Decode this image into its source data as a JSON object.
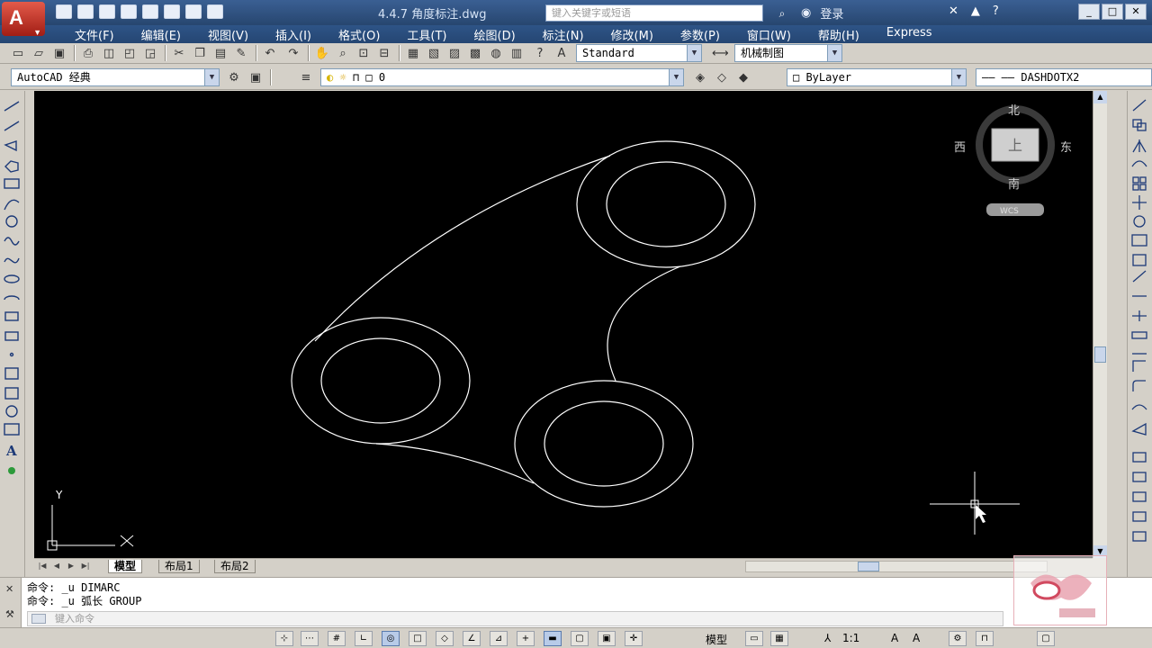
{
  "titlebar": {
    "app_letter": "A",
    "document_title": "4.4.7 角度标注.dwg",
    "search_placeholder": "键入关键字或短语",
    "sign_in": "登录"
  },
  "menubar": {
    "items": [
      "文件(F)",
      "编辑(E)",
      "视图(V)",
      "插入(I)",
      "格式(O)",
      "工具(T)",
      "绘图(D)",
      "标注(N)",
      "修改(M)",
      "参数(P)",
      "窗口(W)",
      "帮助(H)",
      "Express"
    ]
  },
  "toolbar": {
    "text_style": "Standard",
    "dim_style": "机械制图",
    "workspace": "AutoCAD 经典",
    "layer": "0",
    "color": "ByLayer",
    "linetype": "DASHDOTX2"
  },
  "viewcube": {
    "north": "北",
    "south": "南",
    "east": "东",
    "west": "西",
    "face": "上",
    "wcs": "WCS"
  },
  "ucs": {
    "x_label": "X",
    "y_label": "Y"
  },
  "layout_tabs": {
    "tabs": [
      "模型",
      "布局1",
      "布局2"
    ],
    "active": "模型"
  },
  "command": {
    "lines": [
      "命令: _u DIMARC",
      "命令: _u 弧长 GROUP"
    ],
    "input_placeholder": "键入命令"
  },
  "statusbar": {
    "model_label": "模型",
    "scale": "1:1"
  }
}
